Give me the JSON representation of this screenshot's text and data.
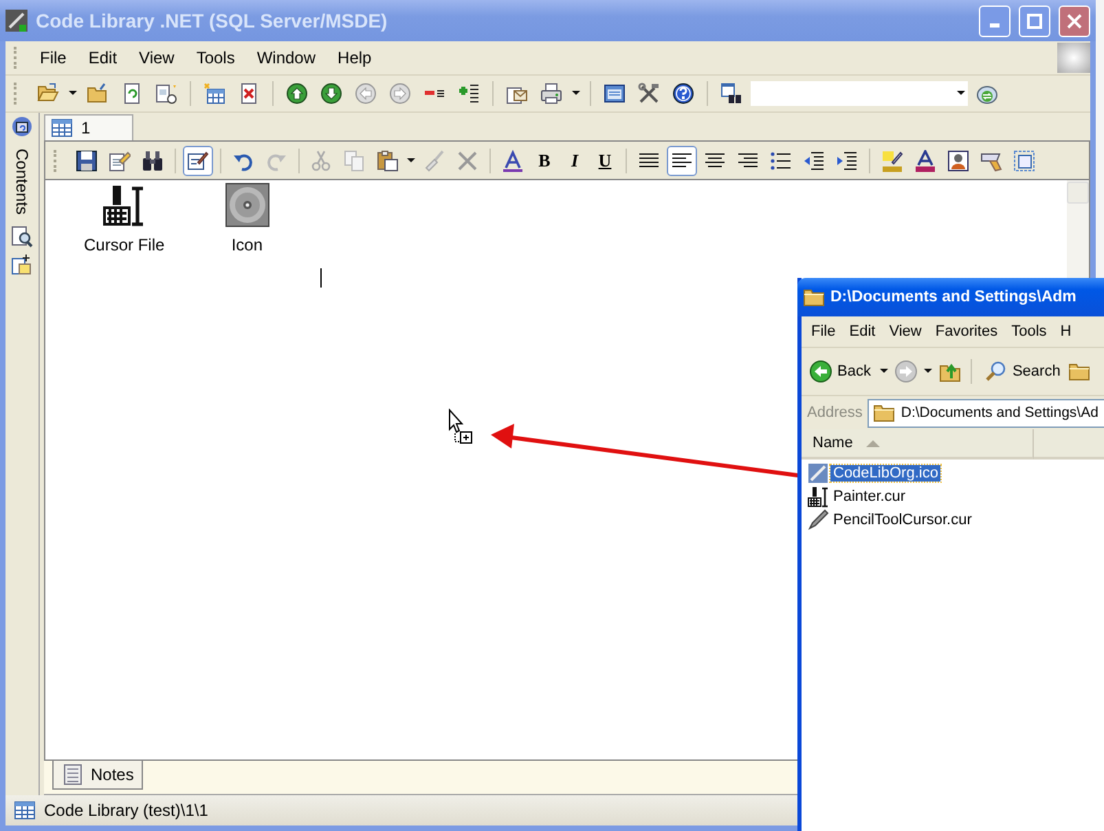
{
  "window": {
    "title": "Code Library .NET (SQL Server/MSDE)"
  },
  "menu": [
    {
      "label": "File"
    },
    {
      "label": "Edit"
    },
    {
      "label": "View"
    },
    {
      "label": "Tools"
    },
    {
      "label": "Window"
    },
    {
      "label": "Help"
    }
  ],
  "sidebar": {
    "label": "Contents"
  },
  "document_tabs": [
    {
      "label": "1",
      "selected": true
    }
  ],
  "editor_toolbar": {
    "edit_toggle": {
      "on": true
    },
    "styles": [
      {
        "label": "B",
        "kind": "bold"
      },
      {
        "label": "I",
        "kind": "italic"
      },
      {
        "label": "U",
        "kind": "underline"
      }
    ],
    "alignment": [
      {
        "kind": "justify",
        "selected": false
      },
      {
        "kind": "left",
        "selected": true
      },
      {
        "kind": "center",
        "selected": false
      },
      {
        "kind": "right",
        "selected": false
      }
    ]
  },
  "editor": {
    "items": [
      {
        "label": "Cursor File",
        "kind": "cursor"
      },
      {
        "label": "Icon",
        "kind": "icon"
      }
    ]
  },
  "bottom_tabs": [
    {
      "label": "Notes",
      "selected": true
    }
  ],
  "status_bar": {
    "text": "Code Library (test)\\1\\1"
  },
  "explorer": {
    "title": "D:\\Documents and Settings\\Adm",
    "menu": [
      {
        "label": "File"
      },
      {
        "label": "Edit"
      },
      {
        "label": "View"
      },
      {
        "label": "Favorites"
      },
      {
        "label": "Tools"
      },
      {
        "label": "H"
      }
    ],
    "toolbar": {
      "back": "Back",
      "search": "Search"
    },
    "address": {
      "label": "Address",
      "value": "D:\\Documents and Settings\\Ad"
    },
    "columns": [
      {
        "label": "Name"
      }
    ],
    "files": [
      {
        "name": "CodeLibOrg.ico",
        "kind": "icon",
        "selected": true
      },
      {
        "name": "Painter.cur",
        "kind": "cursor",
        "selected": false
      },
      {
        "name": "PencilToolCursor.cur",
        "kind": "pencil",
        "selected": false
      }
    ]
  }
}
